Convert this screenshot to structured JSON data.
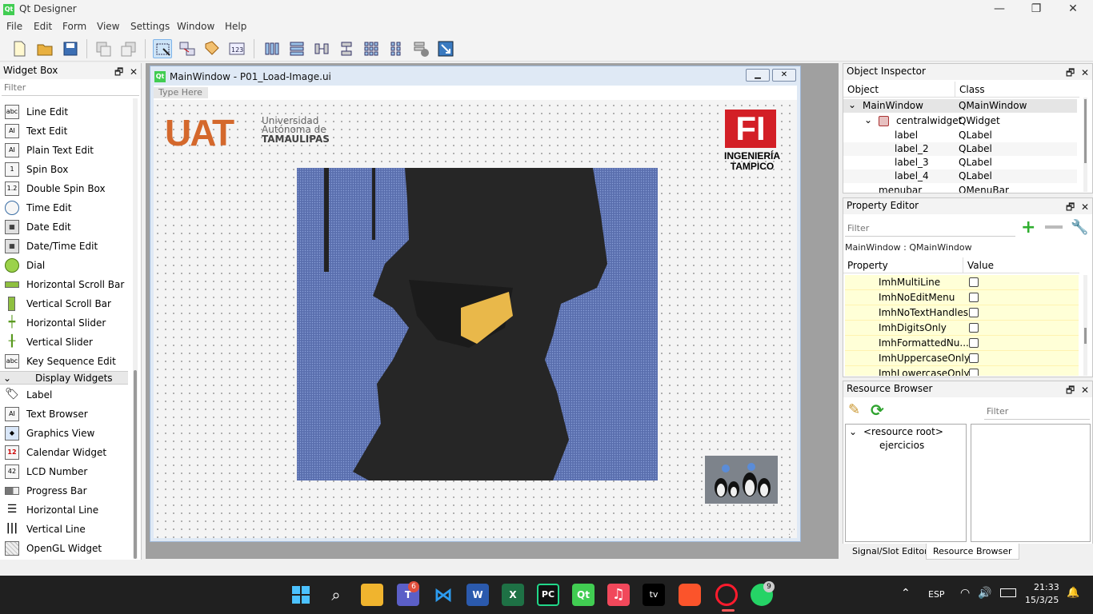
{
  "app": {
    "title": "Qt Designer",
    "logo": "Qt"
  },
  "menu": [
    "File",
    "Edit",
    "Form",
    "View",
    "Settings",
    "Window",
    "Help"
  ],
  "widget_box": {
    "title": "Widget Box",
    "filter_placeholder": "Filter",
    "items": [
      {
        "label": "Line Edit",
        "icon": "line-edit-icon"
      },
      {
        "label": "Text Edit",
        "icon": "text-edit-icon"
      },
      {
        "label": "Plain Text Edit",
        "icon": "plain-text-edit-icon"
      },
      {
        "label": "Spin Box",
        "icon": "spin-box-icon"
      },
      {
        "label": "Double Spin Box",
        "icon": "double-spin-box-icon"
      },
      {
        "label": "Time Edit",
        "icon": "clock-icon"
      },
      {
        "label": "Date Edit",
        "icon": "calendar-icon"
      },
      {
        "label": "Date/Time Edit",
        "icon": "calendar-clock-icon"
      },
      {
        "label": "Dial",
        "icon": "dial-icon"
      },
      {
        "label": "Horizontal Scroll Bar",
        "icon": "h-scrollbar-icon"
      },
      {
        "label": "Vertical Scroll Bar",
        "icon": "v-scrollbar-icon"
      },
      {
        "label": "Horizontal Slider",
        "icon": "h-slider-icon"
      },
      {
        "label": "Vertical Slider",
        "icon": "v-slider-icon"
      },
      {
        "label": "Key Sequence Edit",
        "icon": "key-sequence-icon"
      }
    ],
    "category": "Display Widgets",
    "display_items": [
      {
        "label": "Label",
        "icon": "label-icon"
      },
      {
        "label": "Text Browser",
        "icon": "text-browser-icon"
      },
      {
        "label": "Graphics View",
        "icon": "graphics-view-icon"
      },
      {
        "label": "Calendar Widget",
        "icon": "calendar-widget-icon"
      },
      {
        "label": "LCD Number",
        "icon": "lcd-icon"
      },
      {
        "label": "Progress Bar",
        "icon": "progress-bar-icon"
      },
      {
        "label": "Horizontal Line",
        "icon": "h-line-icon"
      },
      {
        "label": "Vertical Line",
        "icon": "v-line-icon"
      },
      {
        "label": "OpenGL Widget",
        "icon": "opengl-icon"
      }
    ]
  },
  "form": {
    "title": "MainWindow - P01_Load-Image.ui",
    "menu_placeholder": "Type Here",
    "uat": {
      "line1": "Universidad",
      "line2": "Autónoma de",
      "line3": "TAMAULIPAS",
      "mark": "UAT"
    },
    "fi": {
      "mark": "FI",
      "line1": "INGENIERÍA",
      "line2": "TAMPICO"
    }
  },
  "object_inspector": {
    "title": "Object Inspector",
    "columns": [
      "Object",
      "Class"
    ],
    "rows": [
      {
        "object": "MainWindow",
        "class": "QMainWindow"
      },
      {
        "object": "centralwidget",
        "class": "QWidget"
      },
      {
        "object": "label",
        "class": "QLabel"
      },
      {
        "object": "label_2",
        "class": "QLabel"
      },
      {
        "object": "label_3",
        "class": "QLabel"
      },
      {
        "object": "label_4",
        "class": "QLabel"
      },
      {
        "object": "menubar",
        "class": "QMenuBar"
      }
    ]
  },
  "property_editor": {
    "title": "Property Editor",
    "filter_placeholder": "Filter",
    "context": "MainWindow : QMainWindow",
    "columns": [
      "Property",
      "Value"
    ],
    "rows": [
      "ImhMultiLine",
      "ImhNoEditMenu",
      "ImhNoTextHandles",
      "ImhDigitsOnly",
      "ImhFormattedNu...",
      "ImhUppercaseOnly",
      "ImhLowercaseOnly"
    ]
  },
  "resource_browser": {
    "title": "Resource Browser",
    "filter_placeholder": "Filter",
    "root": "<resource root>",
    "child": "ejercicios"
  },
  "tabs": [
    "Signal/Slot Editor",
    "Resource Browser"
  ],
  "taskbar": {
    "lang": "ESP",
    "time": "21:33",
    "date": "15/3/25",
    "teams_badge": "6",
    "whatsapp_badge": "9"
  }
}
